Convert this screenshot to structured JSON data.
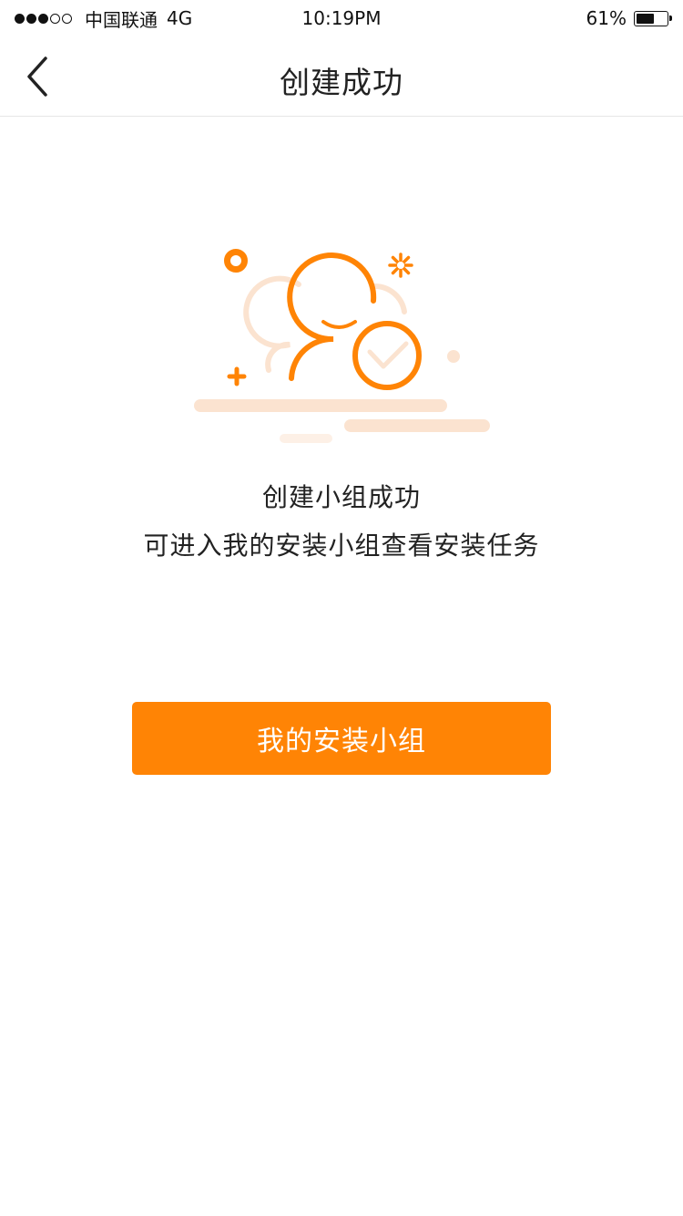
{
  "status_bar": {
    "carrier": "中国联通",
    "network": "4G",
    "time": "10:19PM",
    "battery_percent": "61%",
    "battery_level": 0.61,
    "signal_strength_dots": 3
  },
  "nav": {
    "title": "创建成功",
    "back_icon": "chevron-left-icon"
  },
  "content": {
    "message_title": "创建小组成功",
    "message_desc": "可进入我的安装小组查看安装任务",
    "illustration_icon": "group-success-icon"
  },
  "actions": {
    "my_group_button": "我的安装小组"
  },
  "colors": {
    "accent": "#ff8405",
    "accent_light": "#fbe3d0",
    "text": "#222222",
    "divider": "#e6e6e6"
  }
}
